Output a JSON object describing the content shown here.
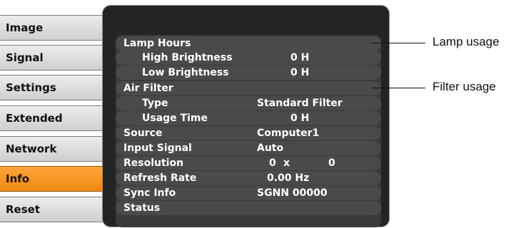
{
  "menu": {
    "tabs": [
      {
        "label": "Image"
      },
      {
        "label": "Signal"
      },
      {
        "label": "Settings"
      },
      {
        "label": "Extended"
      },
      {
        "label": "Network"
      },
      {
        "label": "Info"
      },
      {
        "label": "Reset"
      }
    ],
    "active_tab": "Info"
  },
  "info": {
    "lamp_hours": {
      "label": "Lamp Hours"
    },
    "high_brightness": {
      "label": "High Brightness",
      "value": "0 H"
    },
    "low_brightness": {
      "label": "Low Brightness",
      "value": "0 H"
    },
    "air_filter": {
      "label": "Air Filter"
    },
    "type": {
      "label": "Type",
      "value": "Standard Filter"
    },
    "usage_time": {
      "label": "Usage Time",
      "value": "0 H"
    },
    "source": {
      "label": "Source",
      "value": "Computer1"
    },
    "input_signal": {
      "label": "Input Signal",
      "value": "Auto"
    },
    "resolution": {
      "label": "Resolution",
      "value_w": "0",
      "value_x": "x",
      "value_h": "0"
    },
    "refresh_rate": {
      "label": "Refresh Rate",
      "value": "0.00 Hz"
    },
    "sync_info": {
      "label": "Sync Info",
      "value": "SGNN 00000"
    },
    "status": {
      "label": "Status"
    }
  },
  "callouts": {
    "lamp_usage": "Lamp usage",
    "filter_usage": "Filter usage"
  },
  "colors": {
    "active_tab": "#f59a24",
    "panel_background": "#242424",
    "row_background": "#4a4a4a"
  }
}
